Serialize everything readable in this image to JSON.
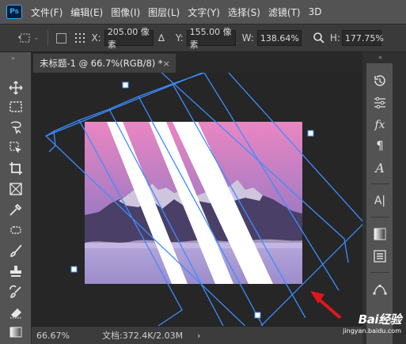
{
  "app": {
    "logo": "Ps"
  },
  "menu": {
    "items": [
      "文件(F)",
      "编辑(E)",
      "图像(I)",
      "图层(L)",
      "文字(Y)",
      "选择(S)",
      "滤镜(T)",
      "3D"
    ]
  },
  "options": {
    "x_label": "X:",
    "x_value": "205.00 像素",
    "y_label": "Y:",
    "y_value": "155.00 像素",
    "w_label": "W:",
    "w_value": "138.64%",
    "h_label": "H:",
    "h_value": "177.75%"
  },
  "document": {
    "tab_title": "未标题-1 @ 66.7%(RGB/8) *",
    "close_glyph": "×"
  },
  "status": {
    "zoom": "66.67%",
    "doc_size": "文档:372.4K/2.03M",
    "arrow": "›"
  },
  "right_panel": {
    "properties_glyph": "fx",
    "type_glyph": "A|"
  },
  "watermark": {
    "brand": "Bai经验",
    "url": "jingyan.baidu.com"
  },
  "colors": {
    "sky_top": "#ea86c2",
    "sky_bottom": "#6b71c4",
    "mountain": "#4a3f66",
    "snow": "#e6ddf2",
    "clouds": "#9f8fcb",
    "transform_outline": "#3d8cff",
    "arrow": "#e0161c"
  }
}
